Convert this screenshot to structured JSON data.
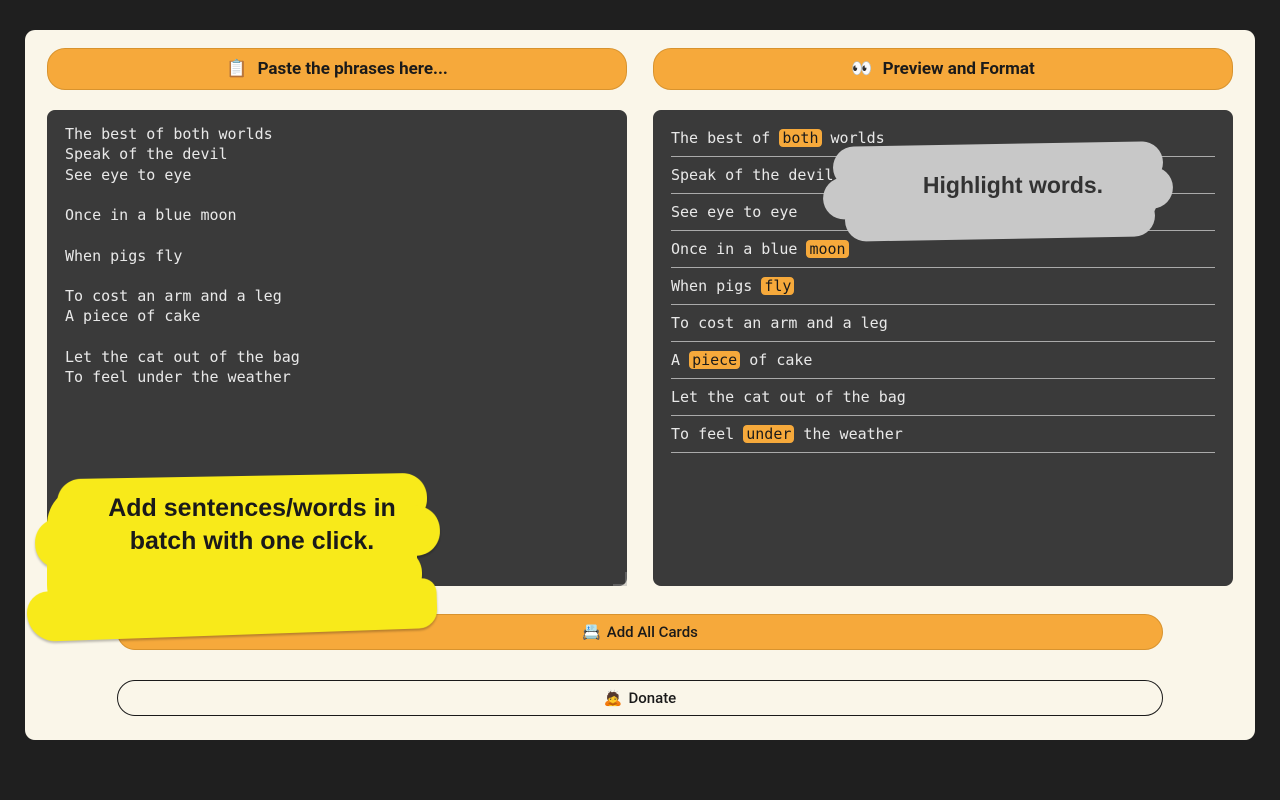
{
  "left": {
    "header_icon": "📋",
    "header_label": "Paste the phrases here...",
    "textarea_value": "The best of both worlds\nSpeak of the devil\nSee eye to eye\n\nOnce in a blue moon\n\nWhen pigs fly\n\nTo cost an arm and a leg\nA piece of cake\n\nLet the cat out of the bag\nTo feel under the weather",
    "callout": "Add sentences/words in batch with one click."
  },
  "right": {
    "header_icon": "👀",
    "header_label": "Preview and Format",
    "lines": [
      {
        "tokens": [
          {
            "t": "The best of "
          },
          {
            "t": "both",
            "hl": true
          },
          {
            "t": " worlds"
          }
        ]
      },
      {
        "tokens": [
          {
            "t": "Speak of the devil"
          }
        ]
      },
      {
        "tokens": [
          {
            "t": "See eye to eye"
          }
        ]
      },
      {
        "tokens": [
          {
            "t": "Once in a blue "
          },
          {
            "t": "moon",
            "hl": true
          }
        ]
      },
      {
        "tokens": [
          {
            "t": "When pigs "
          },
          {
            "t": "fly",
            "hl": true
          }
        ]
      },
      {
        "tokens": [
          {
            "t": "To cost an arm and a leg"
          }
        ]
      },
      {
        "tokens": [
          {
            "t": "A "
          },
          {
            "t": "piece",
            "hl": true
          },
          {
            "t": " of cake"
          }
        ]
      },
      {
        "tokens": [
          {
            "t": "Let the cat out of the bag"
          }
        ]
      },
      {
        "tokens": [
          {
            "t": "To feel "
          },
          {
            "t": "under",
            "hl": true
          },
          {
            "t": " the weather"
          }
        ]
      }
    ],
    "callout": "Highlight words."
  },
  "buttons": {
    "add_icon": "📇",
    "add_label": "Add All Cards",
    "donate_icon": "🙇",
    "donate_label": "Donate"
  }
}
